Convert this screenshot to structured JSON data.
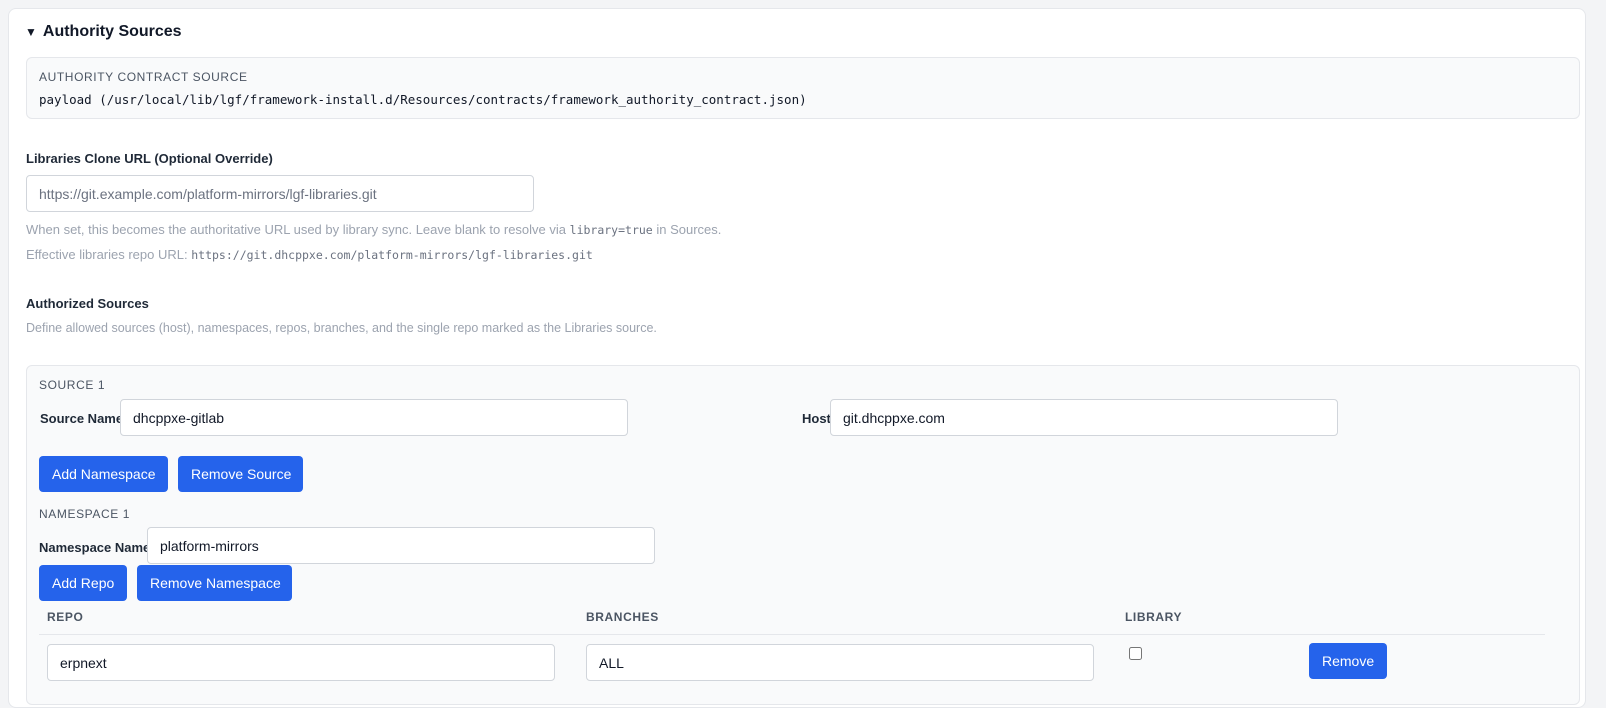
{
  "section": {
    "title": "Authority Sources",
    "caret": "▼"
  },
  "contract": {
    "label": "AUTHORITY CONTRACT SOURCE",
    "value": "payload (/usr/local/lib/lgf/framework-install.d/Resources/contracts/framework_authority_contract.json)"
  },
  "libraries": {
    "label": "Libraries Clone URL (Optional Override)",
    "placeholder": "https://git.example.com/platform-mirrors/lgf-libraries.git",
    "help_prefix": "When set, this becomes the authoritative URL used by library sync. Leave blank to resolve via",
    "help_code": "library=true",
    "help_suffix": "in Sources.",
    "effective_label": "Effective libraries repo URL:",
    "effective_url": "https://git.dhcppxe.com/platform-mirrors/lgf-libraries.git"
  },
  "authorized": {
    "title": "Authorized Sources",
    "description": "Define allowed sources (host), namespaces, repos, branches, and the single repo marked as the Libraries source."
  },
  "sources": [
    {
      "heading": "SOURCE 1",
      "name_label": "Source Name",
      "name_value": "dhcppxe-gitlab",
      "host_label": "Host",
      "host_value": "git.dhcppxe.com",
      "add_namespace_label": "Add Namespace",
      "remove_source_label": "Remove Source",
      "namespaces": [
        {
          "heading": "NAMESPACE 1",
          "name_label": "Namespace Name",
          "name_value": "platform-mirrors",
          "add_repo_label": "Add Repo",
          "remove_namespace_label": "Remove Namespace",
          "columns": [
            "REPO",
            "BRANCHES",
            "LIBRARY"
          ],
          "repos": [
            {
              "repo": "erpnext",
              "branches": "ALL",
              "library": false,
              "remove_label": "Remove"
            }
          ]
        }
      ]
    }
  ],
  "colors": {
    "accent": "#2563eb",
    "panel": "#ffffff",
    "subpanel": "#f9fafb",
    "muted_text": "#9ca3af"
  }
}
